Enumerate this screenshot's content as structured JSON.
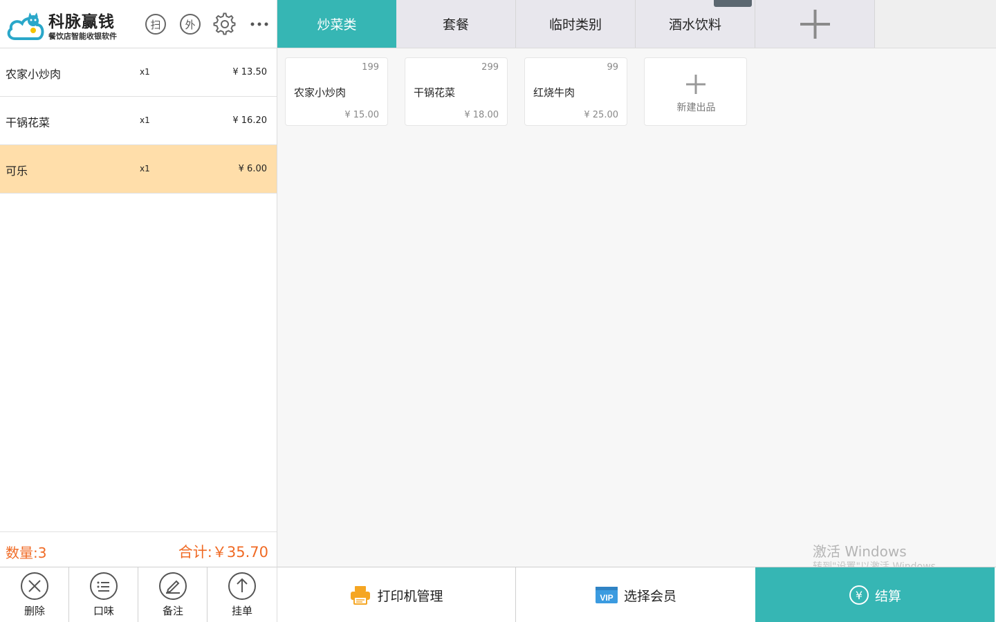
{
  "app": {
    "title": "科脉赢钱",
    "subtitle": "餐饮店智能收银软件",
    "header_icons": [
      {
        "label": "扫",
        "icon": "scan-icon"
      },
      {
        "label": "外",
        "icon": "takeout-icon"
      },
      {
        "label": "",
        "icon": "gear-icon"
      },
      {
        "label": "",
        "icon": "more-dots-icon"
      }
    ]
  },
  "order": {
    "items": [
      {
        "name": "农家小炒肉",
        "qty": "x1",
        "price": "¥ 13.50",
        "selected": false
      },
      {
        "name": "干锅花菜",
        "qty": "x1",
        "price": "¥ 16.20",
        "selected": false
      },
      {
        "name": "可乐",
        "qty": "x1",
        "price": "¥ 6.00",
        "selected": true
      }
    ],
    "count_text": "数量:3",
    "total_text": "合计:￥35.70"
  },
  "actions": [
    {
      "label": "删除",
      "icon": "delete-circle-icon"
    },
    {
      "label": "口味",
      "icon": "list-circle-icon"
    },
    {
      "label": "备注",
      "icon": "pencil-circle-icon"
    },
    {
      "label": "挂单",
      "icon": "arrow-up-circle-icon"
    }
  ],
  "tabs": [
    {
      "label": "炒菜类",
      "active": true
    },
    {
      "label": "套餐",
      "active": false
    },
    {
      "label": "临时类别",
      "active": false
    },
    {
      "label": "酒水饮料",
      "active": false
    }
  ],
  "products": [
    {
      "code": "199",
      "name": "农家小炒肉",
      "price": "¥ 15.00"
    },
    {
      "code": "299",
      "name": "干锅花菜",
      "price": "¥ 18.00"
    },
    {
      "code": "99",
      "name": "红烧牛肉",
      "price": "¥ 25.00"
    }
  ],
  "new_product_label": "新建出品",
  "bottom": {
    "print_label": "打印机管理",
    "member_label": "选择会员",
    "member_badge": "VIP",
    "pay_label": "结算",
    "pay_symbol": "¥"
  },
  "watermark": {
    "line1": "激活 Windows",
    "line2": "转到\"设置\"以激活 Windows。"
  },
  "colors": {
    "accent": "#36b6b4",
    "highlight": "#ffdeaa",
    "total": "#f06a24",
    "print_icon": "#f5a623",
    "vip_icon": "#3b9be0"
  }
}
